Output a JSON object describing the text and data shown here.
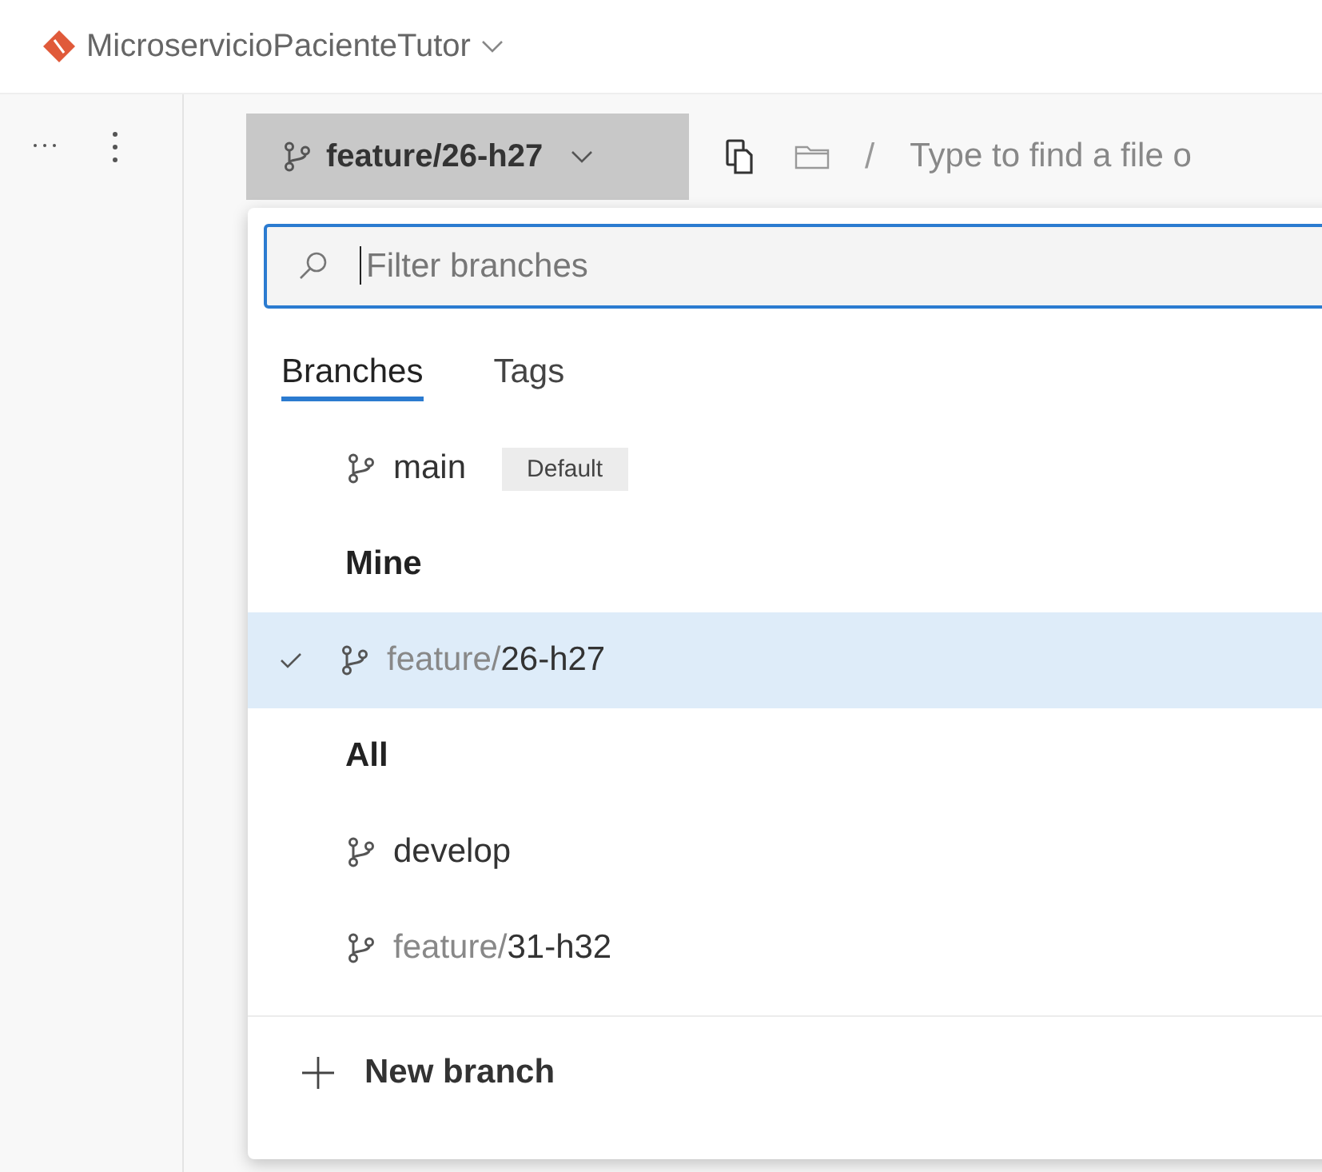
{
  "repo": {
    "name": "MicroservicioPacienteTutor"
  },
  "toolbar": {
    "branch": {
      "folder": "feature/",
      "name": "26-h27"
    },
    "path": {
      "separator": "/",
      "placeholder": "Type to find a file o"
    }
  },
  "dropdown": {
    "filter": {
      "placeholder": "Filter branches"
    },
    "tabs": [
      {
        "label": "Branches",
        "selected": true
      },
      {
        "label": "Tags",
        "selected": false
      }
    ],
    "items": [
      {
        "kind": "branch",
        "name": "main",
        "badge": "Default",
        "selected": false
      },
      {
        "kind": "heading",
        "label": "Mine"
      },
      {
        "kind": "branch",
        "folder": "feature/",
        "name": "26-h27",
        "selected": true
      },
      {
        "kind": "heading",
        "label": "All"
      },
      {
        "kind": "branch",
        "name": "develop",
        "selected": false
      },
      {
        "kind": "branch",
        "folder": "feature/",
        "name": "31-h32",
        "selected": false
      }
    ],
    "action": {
      "label": "New branch"
    }
  }
}
